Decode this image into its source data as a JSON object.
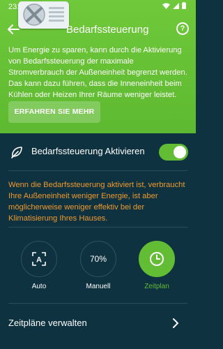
{
  "status": {
    "time": "23:55"
  },
  "header": {
    "title": "Bedarfssteuerung",
    "help_label": "?"
  },
  "intro_text": "Um Energie zu sparen, kann durch die Aktivierung von Bedarfssteuerung der maximale Stromverbrauch der Außeneinheit begrenzt werden. Das kann dazu führen, dass die Inneneinheit beim Kühlen oder Heizen Ihrer Räume weniger leistet.",
  "learn_more_label": "ERFAHREN SIE MEHR",
  "toggle": {
    "label": "Bedarfssteuerung Aktivieren",
    "enabled": true
  },
  "warning_text": "Wenn die Bedarfssteuerung aktiviert ist, verbraucht Ihre Außeneinheit weniger Energie, ist aber möglicherweise weniger effektiv bei der Klimatisierung Ihres Hauses.",
  "modes": [
    {
      "label": "Auto",
      "icon": "auto-mode-icon",
      "active": false
    },
    {
      "label": "Manuell",
      "value": "70%",
      "active": false
    },
    {
      "label": "Zeitplan",
      "icon": "clock-icon",
      "active": true
    }
  ],
  "manage": {
    "label": "Zeitpläne verwalten"
  },
  "colors": {
    "accent": "#63bd34",
    "warning": "#f09a2e",
    "background": "#0f3240",
    "hero": "#6fc93a"
  }
}
